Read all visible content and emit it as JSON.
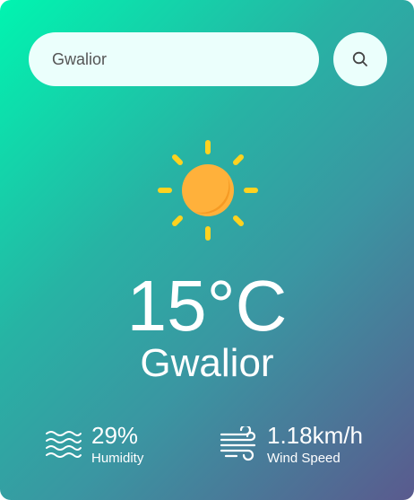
{
  "search": {
    "value": "Gwalior",
    "icon": "search-icon"
  },
  "weather": {
    "icon": "sun-icon",
    "temperature": "15°C",
    "city": "Gwalior"
  },
  "humidity": {
    "value": "29%",
    "label": "Humidity",
    "icon": "waves-icon"
  },
  "wind": {
    "value": "1.18km/h",
    "label": "Wind Speed",
    "icon": "wind-icon"
  },
  "colors": {
    "gradient_start": "#00f5b0",
    "gradient_mid": "#3a96a2",
    "gradient_end": "#5a5a8e",
    "sun_core": "#ffb13b",
    "sun_rays": "#ffd21f",
    "input_bg": "#ebfffc"
  }
}
